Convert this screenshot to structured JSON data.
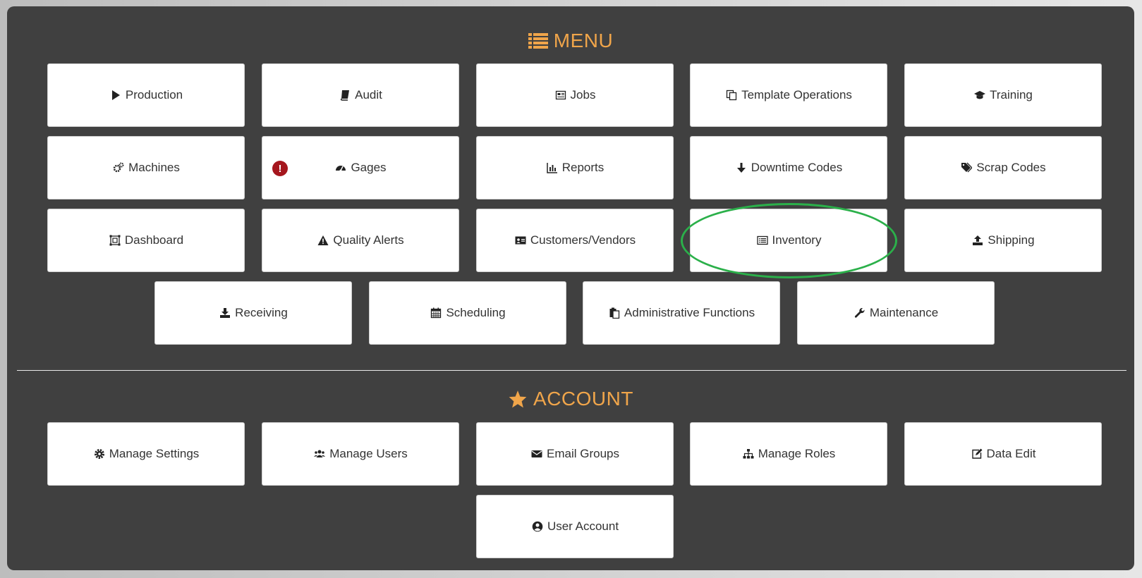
{
  "menu": {
    "title": "MENU",
    "icon": "list-icon",
    "items": [
      {
        "label": "Production",
        "icon": "play-icon"
      },
      {
        "label": "Audit",
        "icon": "book-icon"
      },
      {
        "label": "Jobs",
        "icon": "newspaper-icon"
      },
      {
        "label": "Template Operations",
        "icon": "copy-icon"
      },
      {
        "label": "Training",
        "icon": "graduation-cap-icon"
      },
      {
        "label": "Machines",
        "icon": "cogs-icon"
      },
      {
        "label": "Gages",
        "icon": "gauge-icon",
        "alert": "!"
      },
      {
        "label": "Reports",
        "icon": "bar-chart-icon"
      },
      {
        "label": "Downtime Codes",
        "icon": "arrow-down-icon"
      },
      {
        "label": "Scrap Codes",
        "icon": "tags-icon"
      },
      {
        "label": "Dashboard",
        "icon": "object-group-icon"
      },
      {
        "label": "Quality Alerts",
        "icon": "warning-icon"
      },
      {
        "label": "Customers/Vendors",
        "icon": "address-card-icon"
      },
      {
        "label": "Inventory",
        "icon": "list-alt-icon"
      },
      {
        "label": "Shipping",
        "icon": "upload-icon"
      },
      {
        "label": "Receiving",
        "icon": "download-icon"
      },
      {
        "label": "Scheduling",
        "icon": "calendar-icon"
      },
      {
        "label": "Administrative Functions",
        "icon": "clipboard-icon"
      },
      {
        "label": "Maintenance",
        "icon": "wrench-icon"
      }
    ]
  },
  "account": {
    "title": "ACCOUNT",
    "icon": "star-icon",
    "items": [
      {
        "label": "Manage Settings",
        "icon": "gear-icon"
      },
      {
        "label": "Manage Users",
        "icon": "users-icon"
      },
      {
        "label": "Email Groups",
        "icon": "envelope-icon"
      },
      {
        "label": "Manage Roles",
        "icon": "sitemap-icon"
      },
      {
        "label": "Data Edit",
        "icon": "edit-icon"
      },
      {
        "label": "User Account",
        "icon": "user-circle-icon"
      }
    ]
  },
  "colors": {
    "panel_bg": "#404040",
    "heading": "#f0a54a",
    "tile_bg": "#ffffff",
    "alert_badge": "#a5161d",
    "highlight_ring": "#2bb04a"
  }
}
